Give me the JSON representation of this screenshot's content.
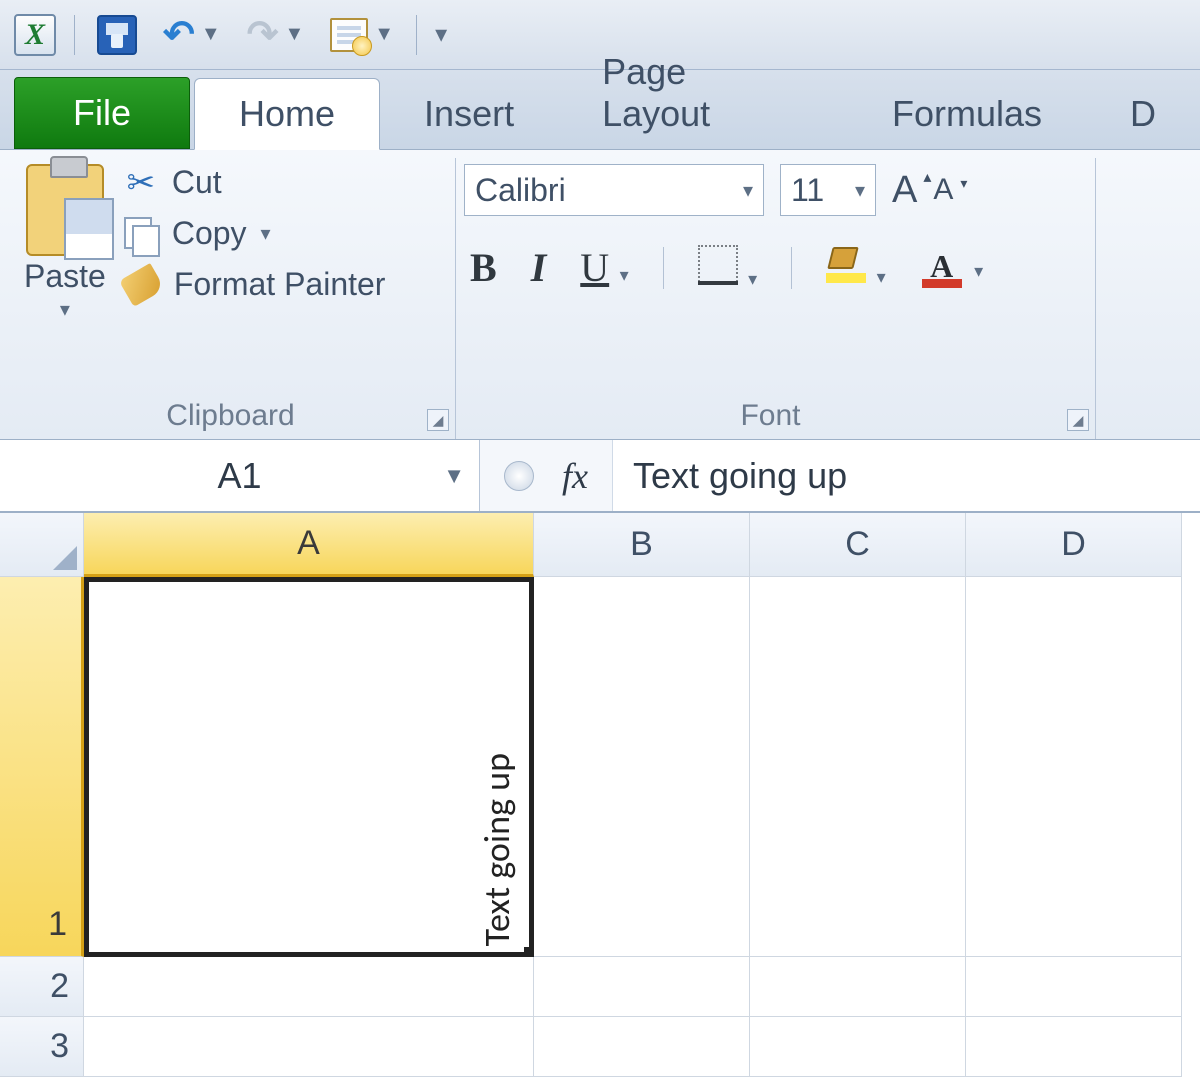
{
  "qat": {
    "undo_caret": "▼",
    "redo_caret": "▼"
  },
  "tabs": {
    "file": "File",
    "home": "Home",
    "insert": "Insert",
    "page_layout": "Page Layout",
    "formulas": "Formulas",
    "data_frag": "D"
  },
  "clipboard": {
    "paste": "Paste",
    "cut": "Cut",
    "copy": "Copy",
    "format_painter": "Format Painter",
    "group_label": "Clipboard"
  },
  "font": {
    "name": "Calibri",
    "size": "11",
    "group_label": "Font",
    "bold": "B",
    "italic": "I",
    "underline": "U",
    "font_color_letter": "A"
  },
  "formula_bar": {
    "name_box": "A1",
    "fx": "fx",
    "value": "Text going up"
  },
  "grid": {
    "columns": [
      "A",
      "B",
      "C",
      "D"
    ],
    "rows": [
      "1",
      "2",
      "3"
    ],
    "A1_text": "Text going up"
  }
}
